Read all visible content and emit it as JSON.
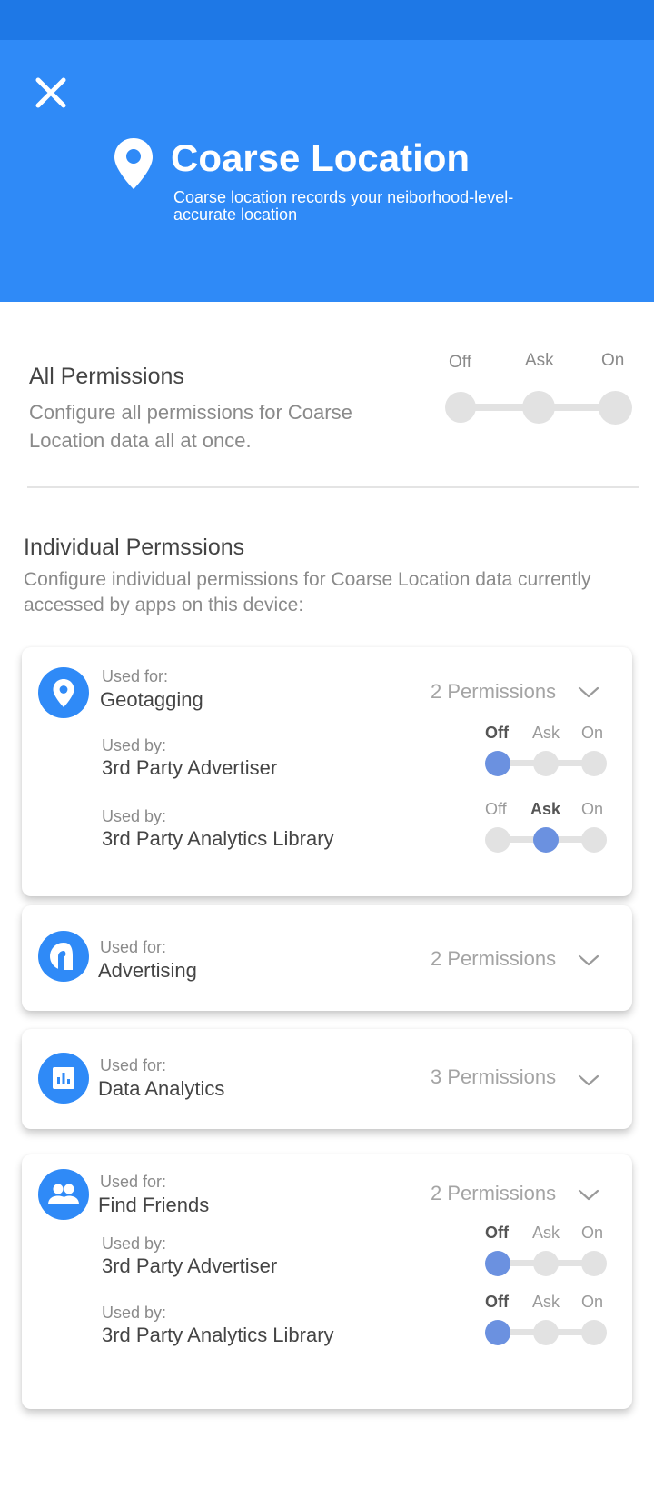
{
  "header": {
    "title": "Coarse Location",
    "subtitle": "Coarse location records your neiborhood-level-accurate location"
  },
  "all_permissions": {
    "title": "All Permissions",
    "description": "Configure all permissions for Coarse Location data all at once.",
    "options": [
      "Off",
      "Ask",
      "On"
    ],
    "selected": null
  },
  "individual": {
    "title": "Individual Permssions",
    "description": "Configure individual permissions for Coarse Location data currently accessed by apps on this device:"
  },
  "colors": {
    "accent": "#2f8af7",
    "status_bar": "#1e78e6",
    "selected_knob": "#6b91e0"
  },
  "cards": [
    {
      "icon": "location-pin-icon",
      "used_for_label": "Used for:",
      "name": "Geotagging",
      "permissions_label": "2 Permissions",
      "expanded": true,
      "entries": [
        {
          "used_by_label": "Used by:",
          "name": "3rd Party Advertiser",
          "options": [
            "Off",
            "Ask",
            "On"
          ],
          "selected": "Off"
        },
        {
          "used_by_label": "Used by:",
          "name": "3rd Party Analytics Library",
          "options": [
            "Off",
            "Ask",
            "On"
          ],
          "selected": "Ask"
        }
      ]
    },
    {
      "icon": "advertising-icon",
      "used_for_label": "Used for:",
      "name": "Advertising",
      "permissions_label": "2 Permissions",
      "expanded": false
    },
    {
      "icon": "bar-chart-icon",
      "used_for_label": "Used for:",
      "name": "Data Analytics",
      "permissions_label": "3 Permissions",
      "expanded": false
    },
    {
      "icon": "people-icon",
      "used_for_label": "Used for:",
      "name": "Find Friends",
      "permissions_label": "2 Permissions",
      "expanded": true,
      "entries": [
        {
          "used_by_label": "Used by:",
          "name": "3rd Party Advertiser",
          "options": [
            "Off",
            "Ask",
            "On"
          ],
          "selected": "Off"
        },
        {
          "used_by_label": "Used by:",
          "name": "3rd Party Analytics Library",
          "options": [
            "Off",
            "Ask",
            "On"
          ],
          "selected": "Off"
        }
      ]
    }
  ]
}
